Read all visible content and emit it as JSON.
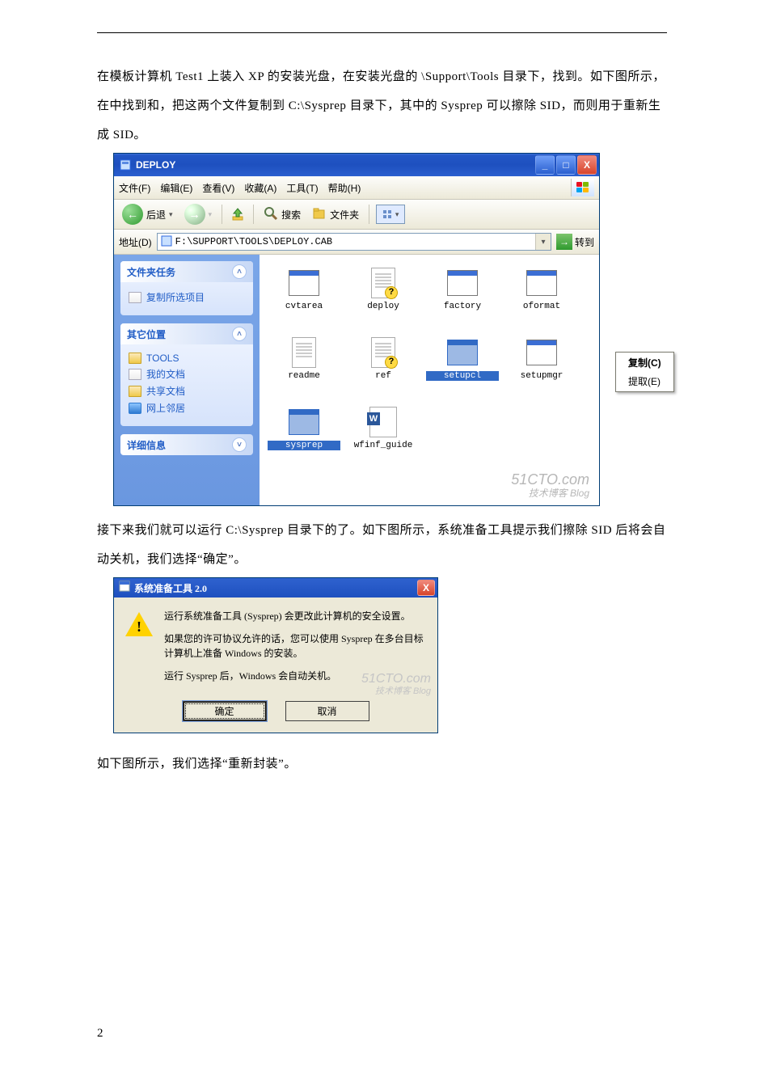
{
  "doc": {
    "para1": "在模板计算机 Test1 上装入 XP 的安装光盘，在安装光盘的 \\Support\\Tools 目录下，找到。如下图所示，在中找到和，把这两个文件复制到 C:\\Sysprep 目录下，其中的 Sysprep 可以擦除 SID，而则用于重新生成 SID。",
    "para2": "接下来我们就可以运行 C:\\Sysprep 目录下的了。如下图所示，系统准备工具提示我们擦除 SID 后将会自动关机，我们选择“确定”。",
    "para3": "如下图所示，我们选择“重新封装”。",
    "page_num": "2"
  },
  "explorer": {
    "title": "DEPLOY",
    "menu": {
      "file": "文件(F)",
      "edit": "编辑(E)",
      "view": "查看(V)",
      "fav": "收藏(A)",
      "tool": "工具(T)",
      "help": "帮助(H)"
    },
    "toolbar": {
      "back": "后退",
      "search": "搜索",
      "folders": "文件夹"
    },
    "address": {
      "label": "地址(D)",
      "path": "F:\\SUPPORT\\TOOLS\\DEPLOY.CAB",
      "go": "转到"
    },
    "side": {
      "tasks_head": "文件夹任务",
      "tasks_item": "复制所选项目",
      "other_head": "其它位置",
      "other_items": [
        "TOOLS",
        "我的文档",
        "共享文档",
        "网上邻居"
      ],
      "detail_head": "详细信息"
    },
    "files": [
      "cvtarea",
      "deploy",
      "factory",
      "oformat",
      "readme",
      "ref",
      "setupcl",
      "setupmgr",
      "sysprep",
      "wfinf_guide"
    ],
    "ctx": {
      "copy": "复制(C)",
      "extract": "提取(E)"
    },
    "watermark_big": "51CTO.com",
    "watermark_small": "技术博客  Blog"
  },
  "dialog": {
    "title": "系统准备工具 2.0",
    "line1": "运行系统准备工具 (Sysprep) 会更改此计算机的安全设置。",
    "line2": "如果您的许可协议允许的话，您可以使用 Sysprep 在多台目标计算机上准备 Windows 的安装。",
    "line3": "运行 Sysprep 后，Windows 会自动关机。",
    "ok": "确定",
    "cancel": "取消",
    "watermark_big": "51CTO.com",
    "watermark_small": "技术博客  Blog"
  }
}
